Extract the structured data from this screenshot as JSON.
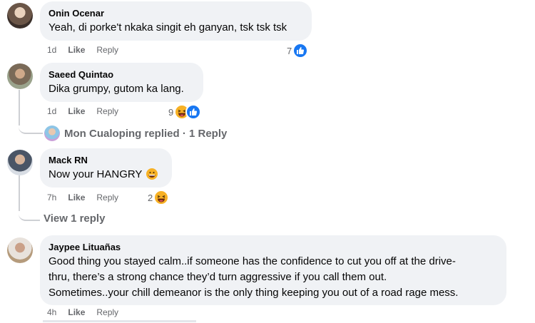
{
  "comments": [
    {
      "author": "Onin Ocenar",
      "text": "Yeah, di porke't nkaka singit eh ganyan, tsk tsk tsk",
      "time": "1d",
      "like": "Like",
      "reply": "Reply",
      "reaction_count": "7",
      "reactions": [
        "like-icon"
      ]
    },
    {
      "author": "Saeed Quintao",
      "text": "Dika grumpy, gutom ka lang.",
      "time": "1d",
      "like": "Like",
      "reply": "Reply",
      "reaction_count": "9",
      "reactions": [
        "haha-icon",
        "like-icon"
      ],
      "replies_summary": "Mon Cualoping replied · 1 Reply"
    },
    {
      "author": "Mack RN",
      "text": "Now your HANGRY",
      "time": "7h",
      "like": "Like",
      "reply": "Reply",
      "reaction_count": "2",
      "reactions": [
        "haha-icon"
      ],
      "view_replies": "View 1 reply"
    },
    {
      "author": "Jaypee Lituañas",
      "text_lines": [
        "Good thing you stayed calm..if someone has the confidence to cut you off at the drive-",
        "thru, there’s a strong chance they’d turn aggressive if you call them out.",
        "Sometimes..your chill demeanor is the only thing keeping you out of a road rage mess."
      ],
      "time": "4h",
      "like": "Like",
      "reply": "Reply"
    }
  ],
  "colors": {
    "bubble": "#f0f2f5",
    "secondary_text": "#65676b",
    "like_blue": "#1877f2",
    "haha_yellow": "#f7b125",
    "thread_line": "#ced0d4"
  }
}
